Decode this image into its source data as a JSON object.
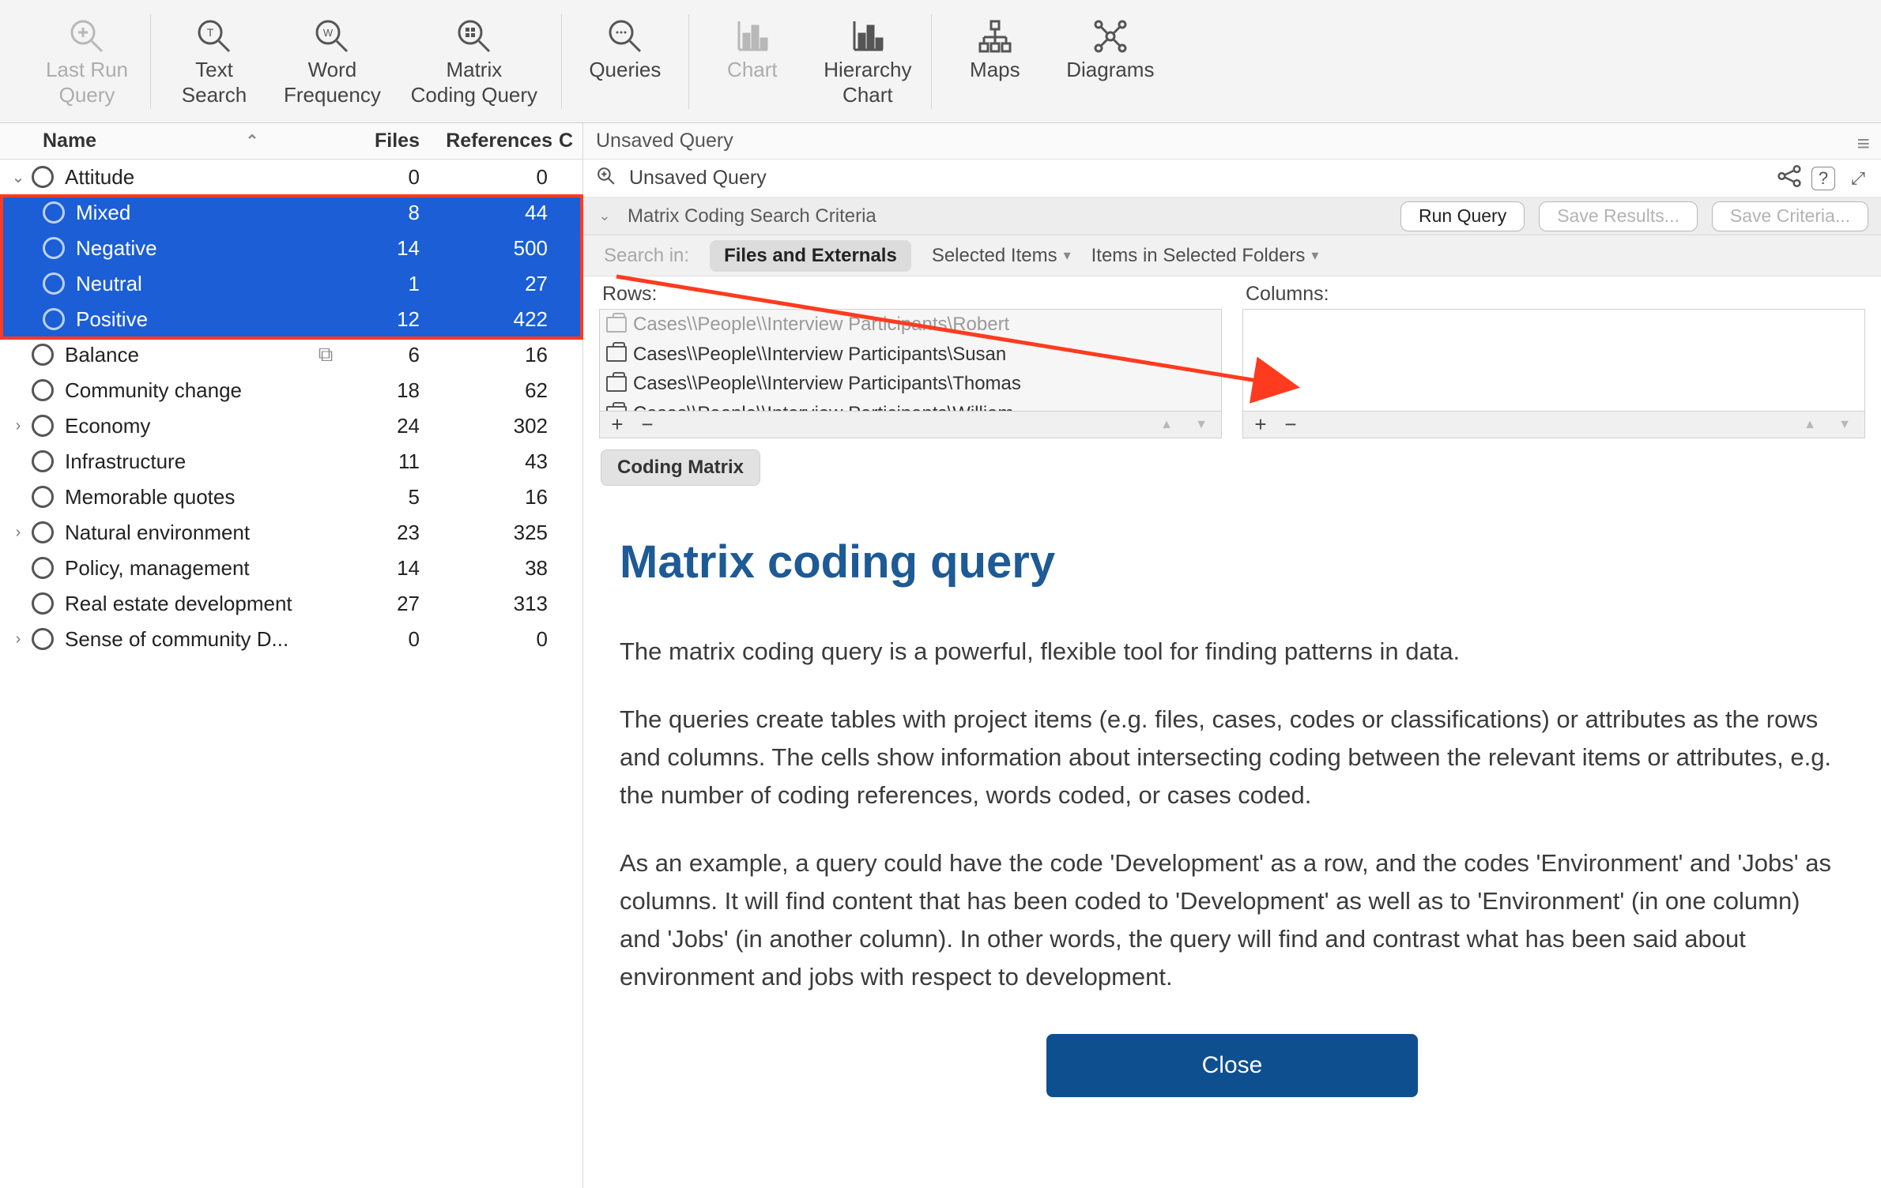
{
  "toolbar": {
    "items": [
      {
        "label_l1": "Last Run",
        "label_l2": "Query",
        "disabled": true
      },
      {
        "label_l1": "Text",
        "label_l2": "Search",
        "disabled": false
      },
      {
        "label_l1": "Word",
        "label_l2": "Frequency",
        "disabled": false
      },
      {
        "label_l1": "Matrix",
        "label_l2": "Coding Query",
        "disabled": false
      },
      {
        "label_l1": "Queries",
        "label_l2": "",
        "disabled": false
      },
      {
        "label_l1": "Chart",
        "label_l2": "",
        "disabled": true
      },
      {
        "label_l1": "Hierarchy",
        "label_l2": "Chart",
        "disabled": false
      },
      {
        "label_l1": "Maps",
        "label_l2": "",
        "disabled": false
      },
      {
        "label_l1": "Diagrams",
        "label_l2": "",
        "disabled": false
      }
    ]
  },
  "list": {
    "headers": {
      "name": "Name",
      "files": "Files",
      "refs": "References",
      "ext": "C"
    },
    "rows": [
      {
        "name": "Attitude",
        "files": "0",
        "refs": "0",
        "lvl": 0,
        "exp": "open",
        "sel": false
      },
      {
        "name": "Mixed",
        "files": "8",
        "refs": "44",
        "lvl": 1,
        "exp": "",
        "sel": true
      },
      {
        "name": "Negative",
        "files": "14",
        "refs": "500",
        "lvl": 1,
        "exp": "",
        "sel": true
      },
      {
        "name": "Neutral",
        "files": "1",
        "refs": "27",
        "lvl": 1,
        "exp": "",
        "sel": true
      },
      {
        "name": "Positive",
        "files": "12",
        "refs": "422",
        "lvl": 1,
        "exp": "",
        "sel": true
      },
      {
        "name": "Balance",
        "files": "6",
        "refs": "16",
        "lvl": 0,
        "exp": "",
        "sel": false,
        "link": true
      },
      {
        "name": "Community change",
        "files": "18",
        "refs": "62",
        "lvl": 0,
        "exp": "",
        "sel": false
      },
      {
        "name": "Economy",
        "files": "24",
        "refs": "302",
        "lvl": 0,
        "exp": "closed",
        "sel": false
      },
      {
        "name": "Infrastructure",
        "files": "11",
        "refs": "43",
        "lvl": 0,
        "exp": "",
        "sel": false
      },
      {
        "name": "Memorable quotes",
        "files": "5",
        "refs": "16",
        "lvl": 0,
        "exp": "",
        "sel": false
      },
      {
        "name": "Natural environment",
        "files": "23",
        "refs": "325",
        "lvl": 0,
        "exp": "closed",
        "sel": false
      },
      {
        "name": "Policy, management",
        "files": "14",
        "refs": "38",
        "lvl": 0,
        "exp": "",
        "sel": false
      },
      {
        "name": "Real estate development",
        "files": "27",
        "refs": "313",
        "lvl": 0,
        "exp": "",
        "sel": false
      },
      {
        "name": "Sense of community D...",
        "files": "0",
        "refs": "0",
        "lvl": 0,
        "exp": "closed",
        "sel": false
      }
    ]
  },
  "query": {
    "tab_title": "Unsaved Query",
    "sub_title": "Unsaved Query",
    "criteria_label": "Matrix Coding Search Criteria",
    "run": "Run Query",
    "save_results": "Save Results...",
    "save_criteria": "Save Criteria...",
    "search_in_label": "Search in:",
    "search_opts": {
      "files": "Files and Externals",
      "selected": "Selected Items",
      "folders": "Items in Selected Folders"
    },
    "rows_label": "Rows:",
    "cols_label": "Columns:",
    "row_items": [
      "Cases\\\\People\\\\Interview Participants\\Robert",
      "Cases\\\\People\\\\Interview Participants\\Susan",
      "Cases\\\\People\\\\Interview Participants\\Thomas",
      "Cases\\\\People\\\\Interview Participants\\William"
    ],
    "coding_chip": "Coding Matrix"
  },
  "article": {
    "title": "Matrix coding query",
    "p1": "The matrix coding query is a powerful, flexible tool for finding patterns in data.",
    "p2": "The queries create tables with project items (e.g. files, cases, codes or classifications) or attributes as the rows and columns. The cells show information about intersecting coding between the relevant items or attributes, e.g. the number of coding references, words coded, or cases coded.",
    "p3": "As an example, a query could have the code 'Development' as a row, and the codes 'Environment' and 'Jobs' as columns. It will find content that has been coded to 'Development' as well as to 'Environment' (in one column) and 'Jobs' (in another column). In other words, the query will find and contrast what has been said about environment and jobs with respect to development.",
    "close": "Close"
  },
  "icons": {
    "share": "⫘",
    "help": "?",
    "expand": "⤢",
    "menu": "≡"
  }
}
